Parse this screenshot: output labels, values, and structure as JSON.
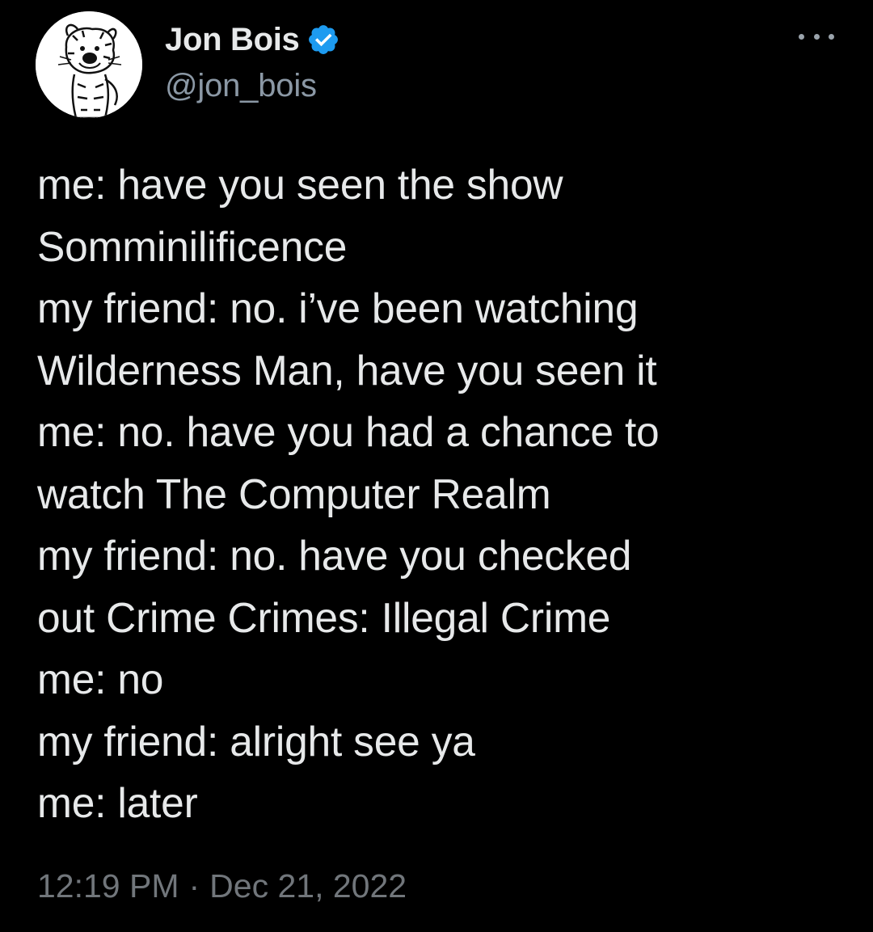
{
  "author": {
    "display_name": "Jon Bois",
    "handle": "@jon_bois",
    "verified": true,
    "verified_color": "#1d9bf0",
    "avatar_icon": "hobbes-avatar-icon"
  },
  "more_icon": "more-options-icon",
  "tweet": {
    "lines": [
      "me: have you seen the show",
      "Somminilificence",
      "my friend: no. i’ve been watching",
      "Wilderness Man, have you seen it",
      "me: no. have you had a chance to",
      "watch The Computer Realm",
      "my friend: no. have you checked",
      "out Crime Crimes: Illegal Crime",
      "me: no",
      "my friend: alright see ya",
      "me: later"
    ]
  },
  "meta": {
    "time": "12:19 PM",
    "separator": "·",
    "date": "Dec 21, 2022"
  }
}
